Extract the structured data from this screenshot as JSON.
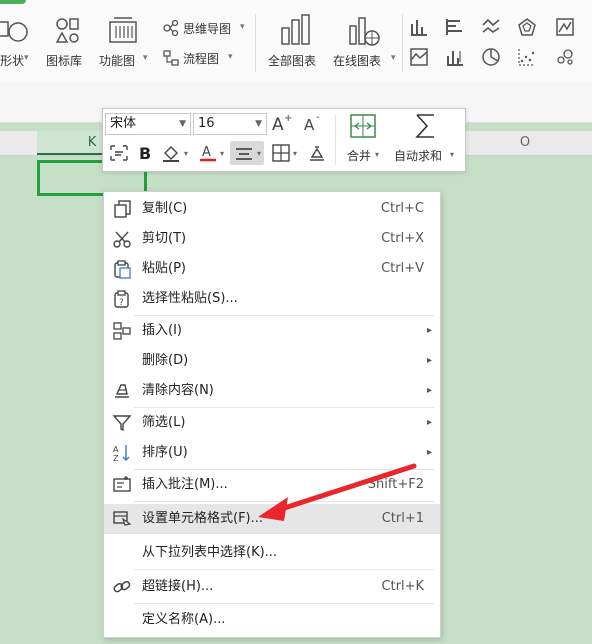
{
  "ribbon": {
    "items": [
      {
        "label": "形状"
      },
      {
        "label": "图标库"
      },
      {
        "label": "功能图"
      },
      {
        "label": "思维导图"
      },
      {
        "label": "流程图"
      },
      {
        "label": "全部图表"
      },
      {
        "label": "在线图表"
      }
    ]
  },
  "columns": {
    "selected": "K",
    "other": "O"
  },
  "mini_toolbar": {
    "font_name": "宋体",
    "font_size": "16",
    "merge_label": "合并",
    "autosum_label": "自动求和"
  },
  "menu": {
    "items": [
      {
        "label": "复制(C)",
        "shortcut": "Ctrl+C",
        "icon": "copy-icon"
      },
      {
        "label": "剪切(T)",
        "shortcut": "Ctrl+X",
        "icon": "scissors-icon"
      },
      {
        "label": "粘贴(P)",
        "shortcut": "Ctrl+V",
        "icon": "paste-icon"
      },
      {
        "label": "选择性粘贴(S)...",
        "shortcut": "",
        "icon": "paste-special-icon"
      },
      {
        "label": "插入(I)",
        "shortcut": "",
        "icon": "insert-icon"
      },
      {
        "label": "删除(D)",
        "shortcut": "",
        "icon": ""
      },
      {
        "label": "清除内容(N)",
        "shortcut": "",
        "icon": "eraser-icon"
      },
      {
        "label": "筛选(L)",
        "shortcut": "",
        "icon": "filter-icon"
      },
      {
        "label": "排序(U)",
        "shortcut": "",
        "icon": "sort-icon"
      },
      {
        "label": "插入批注(M)...",
        "shortcut": "Shift+F2",
        "icon": "comment-icon"
      },
      {
        "label": "设置单元格格式(F)...",
        "shortcut": "Ctrl+1",
        "icon": "format-cells-icon"
      },
      {
        "label": "从下拉列表中选择(K)...",
        "shortcut": "",
        "icon": ""
      },
      {
        "label": "超链接(H)...",
        "shortcut": "Ctrl+K",
        "icon": "link-icon"
      },
      {
        "label": "定义名称(A)...",
        "shortcut": "",
        "icon": ""
      }
    ]
  },
  "colors": {
    "accent": "#22a03a",
    "arrow": "#e8262b",
    "sheet": "#c6e0c8"
  }
}
